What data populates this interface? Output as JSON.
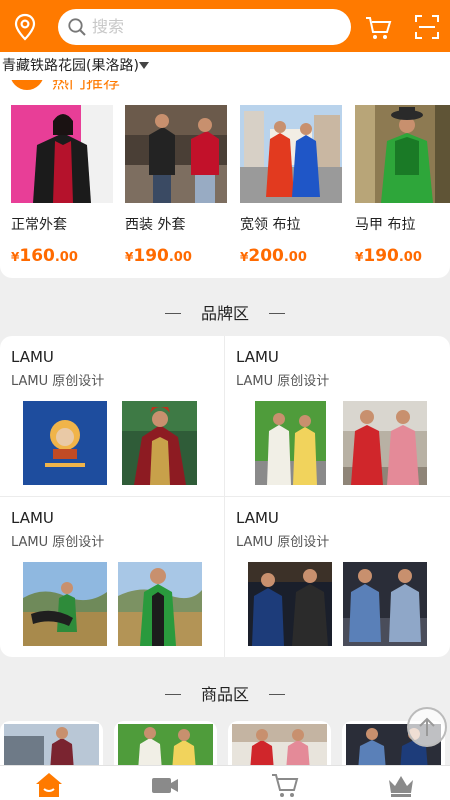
{
  "header": {
    "search_placeholder": "搜索",
    "location": "青藏铁路花园(果洛路)",
    "accent_color": "#ff7a00",
    "icons": [
      "location-pin-icon",
      "search-icon",
      "cart-icon",
      "scan-icon"
    ]
  },
  "hot": {
    "title": "热门推荐",
    "items": [
      {
        "name": "正常外套",
        "price_int": "160",
        "price_dec": ".00",
        "currency": "¥"
      },
      {
        "name": "西装 外套",
        "price_int": "190",
        "price_dec": ".00",
        "currency": "¥"
      },
      {
        "name": "宽领 布拉",
        "price_int": "200",
        "price_dec": ".00",
        "currency": "¥"
      },
      {
        "name": "马甲 布拉",
        "price_int": "190",
        "price_dec": ".00",
        "currency": "¥"
      }
    ]
  },
  "brand_section": {
    "title": "品牌区",
    "brands": [
      {
        "name": "LAMU",
        "subtitle": "LAMU 原创设计"
      },
      {
        "name": "LAMU",
        "subtitle": "LAMU 原创设计"
      },
      {
        "name": "LAMU",
        "subtitle": "LAMU 原创设计"
      },
      {
        "name": "LAMU",
        "subtitle": "LAMU 原创设计"
      }
    ]
  },
  "product_section": {
    "title": "商品区"
  },
  "tabbar": {
    "icons": [
      "home-icon",
      "video-icon",
      "cart-icon",
      "crown-icon"
    ],
    "active_color": "#ff7a00"
  }
}
